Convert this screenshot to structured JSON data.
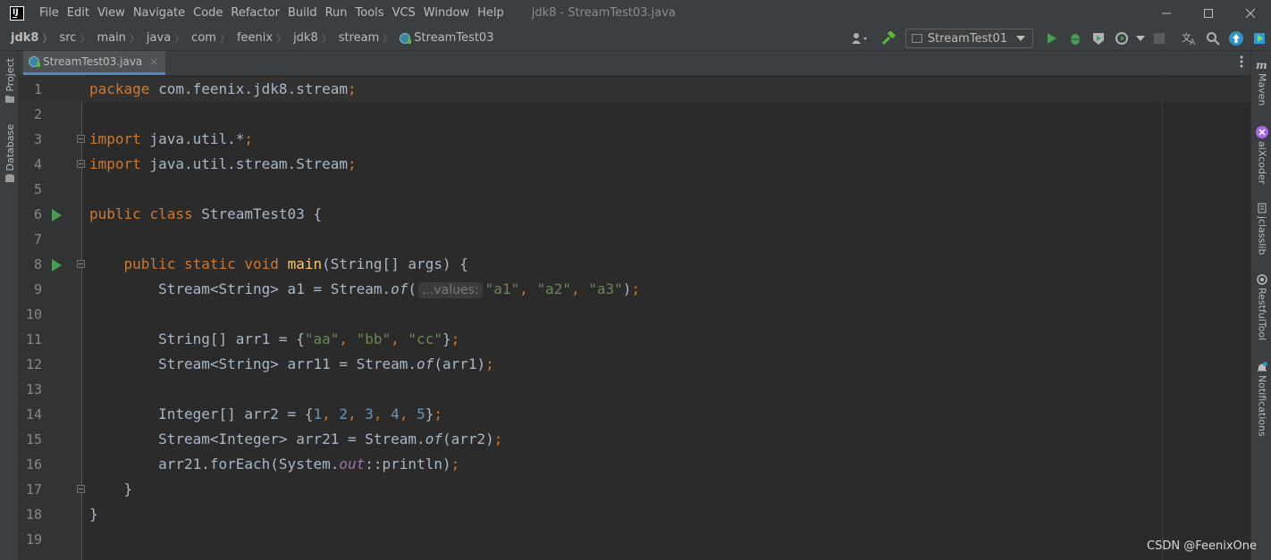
{
  "app": {
    "logo_text": "IJ",
    "window_title": "jdk8 - StreamTest03.java"
  },
  "menu": [
    "File",
    "Edit",
    "View",
    "Navigate",
    "Code",
    "Refactor",
    "Build",
    "Run",
    "Tools",
    "VCS",
    "Window",
    "Help"
  ],
  "breadcrumbs": [
    "jdk8",
    "src",
    "main",
    "java",
    "com",
    "feenix",
    "jdk8",
    "stream",
    "StreamTest03"
  ],
  "toolbar": {
    "run_config": "StreamTest01",
    "icons": [
      "user-icon",
      "build-icon",
      "run-icon",
      "debug-icon",
      "coverage-icon",
      "profile-icon",
      "stop-icon",
      "translate-icon",
      "search-icon",
      "update-icon",
      "plugin-icon"
    ]
  },
  "left_tools": [
    "Project",
    "Database"
  ],
  "right_tools": [
    "Maven",
    "aiXcoder",
    "jclasslib",
    "RestfulTool",
    "Notifications"
  ],
  "tab": {
    "filename": "StreamTest03.java",
    "close": "×"
  },
  "editor": {
    "inlay_hint": "...values:",
    "lines": [
      {
        "num": "1",
        "text": "package com.feenix.jdk8.stream;"
      },
      {
        "num": "2",
        "text": ""
      },
      {
        "num": "3",
        "text": "import java.util.*;"
      },
      {
        "num": "4",
        "text": "import java.util.stream.Stream;"
      },
      {
        "num": "5",
        "text": ""
      },
      {
        "num": "6",
        "text": "public class StreamTest03 {"
      },
      {
        "num": "7",
        "text": ""
      },
      {
        "num": "8",
        "text": "    public static void main(String[] args) {"
      },
      {
        "num": "9",
        "text": "        Stream<String> a1 = Stream.of(\"a1\", \"a2\", \"a3\");"
      },
      {
        "num": "10",
        "text": ""
      },
      {
        "num": "11",
        "text": "        String[] arr1 = {\"aa\", \"bb\", \"cc\"};"
      },
      {
        "num": "12",
        "text": "        Stream<String> arr11 = Stream.of(arr1);"
      },
      {
        "num": "13",
        "text": ""
      },
      {
        "num": "14",
        "text": "        Integer[] arr2 = {1, 2, 3, 4, 5};"
      },
      {
        "num": "15",
        "text": "        Stream<Integer> arr21 = Stream.of(arr2);"
      },
      {
        "num": "16",
        "text": "        arr21.forEach(System.out::println);"
      },
      {
        "num": "17",
        "text": "    }"
      },
      {
        "num": "18",
        "text": "}"
      },
      {
        "num": "19",
        "text": ""
      }
    ]
  },
  "watermark": "CSDN @FeenixOne",
  "colors": {
    "keyword": "#cc7832",
    "string": "#6a8759",
    "number": "#6897bb",
    "method": "#ffc66d",
    "field": "#9876aa",
    "run_green": "#499c54",
    "accent_blue": "#4a88c7"
  }
}
